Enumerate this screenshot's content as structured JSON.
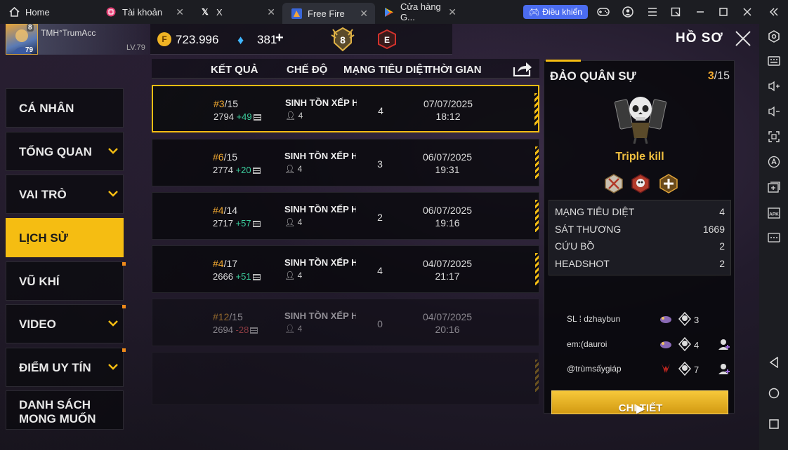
{
  "browser": {
    "tabs": [
      {
        "label": "Home",
        "icon": "home-icon"
      },
      {
        "label": "Tài khoản",
        "icon": "app-icon"
      },
      {
        "label": "X",
        "icon": "x-icon"
      },
      {
        "label": "Free Fire",
        "icon": "freefire-icon"
      },
      {
        "label": "Cửa hàng G...",
        "icon": "play-store-icon"
      }
    ],
    "control_button": "Điều khiển"
  },
  "header": {
    "player_name": "TMH°TrumAcc",
    "player_level": "LV.79",
    "avatar_level": "79",
    "avatar_rank": "8",
    "gold": "723.996",
    "diamonds": "381",
    "rank_emblem_text": "8",
    "e_emblem_text": "E",
    "page_title": "HỒ SƠ"
  },
  "nav": {
    "items": [
      {
        "label": "CÁ NHÂN",
        "chevron": false,
        "dot": false
      },
      {
        "label": "TỔNG QUAN",
        "chevron": true,
        "dot": false
      },
      {
        "label": "VAI TRÒ",
        "chevron": true,
        "dot": false
      },
      {
        "label": "LỊCH SỬ",
        "chevron": false,
        "dot": false,
        "active": true
      },
      {
        "label": "VŨ KHÍ",
        "chevron": false,
        "dot": true
      },
      {
        "label": "VIDEO",
        "chevron": true,
        "dot": true
      },
      {
        "label": "ĐIỂM UY TÍN",
        "chevron": true,
        "dot": true
      },
      {
        "label": "DANH SÁCH",
        "label2": "MONG MUỐN",
        "chevron": false,
        "dot": false
      }
    ]
  },
  "table": {
    "headers": {
      "result": "KẾT QUẢ",
      "mode": "CHẾ ĐỘ",
      "kills": "MẠNG TIÊU DIỆT",
      "time": "THỜI GIAN"
    },
    "rows": [
      {
        "rank": "#3",
        "total": "/15",
        "points": "2794",
        "delta": "+49",
        "mode": "SINH TỒN XẾP HẠ",
        "team": "4",
        "kills": "4",
        "date": "07/07/2025",
        "time": "18:12"
      },
      {
        "rank": "#6",
        "total": "/15",
        "points": "2774",
        "delta": "+20",
        "mode": "SINH TỒN XẾP HẠ",
        "team": "4",
        "kills": "3",
        "date": "06/07/2025",
        "time": "19:31"
      },
      {
        "rank": "#4",
        "total": "/14",
        "points": "2717",
        "delta": "+57",
        "mode": "SINH TỒN XẾP HẠ",
        "team": "4",
        "kills": "2",
        "date": "06/07/2025",
        "time": "19:16"
      },
      {
        "rank": "#4",
        "total": "/17",
        "points": "2666",
        "delta": "+51",
        "mode": "SINH TỒN XẾP HẠ",
        "team": "4",
        "kills": "4",
        "date": "04/07/2025",
        "time": "21:17"
      },
      {
        "rank": "#12",
        "total": "/15",
        "points": "2694",
        "delta": "-28",
        "mode": "SINH TỒN XẾP HẠ",
        "team": "4",
        "kills": "0",
        "date": "04/07/2025",
        "time": "20:16"
      }
    ]
  },
  "detail": {
    "map": "ĐẢO QUÂN SỰ",
    "rank": "3",
    "total": "/15",
    "achievement": "Triple kill",
    "stats": [
      {
        "label": "MẠNG TIÊU DIỆT",
        "value": "4"
      },
      {
        "label": "SÁT THƯƠNG",
        "value": "1669"
      },
      {
        "label": "CỨU BỒ",
        "value": "2"
      },
      {
        "label": "HEADSHOT",
        "value": "2"
      }
    ],
    "team": [
      {
        "name": "SL ⁞ dzhaybun",
        "kills": "3"
      },
      {
        "name": "em:(dauroi",
        "kills": "4"
      },
      {
        "name": "@trùmsấygiáp",
        "kills": "7"
      }
    ],
    "button": "CHI TIẾT"
  },
  "colors": {
    "accent": "#f5bd12",
    "delta_up": "#3ccf9e",
    "delta_down": "#e05555",
    "rank_orange": "#f0a830"
  }
}
